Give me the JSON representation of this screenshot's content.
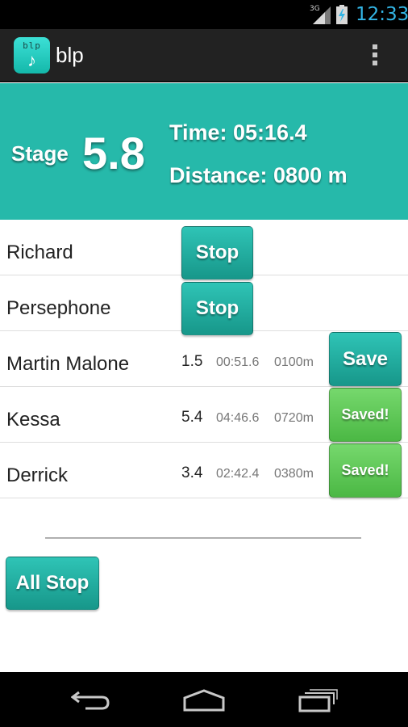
{
  "status_bar": {
    "network": "3G",
    "time": "12:33",
    "icons": [
      "signal-icon",
      "battery-charging-icon"
    ]
  },
  "action_bar": {
    "app_name": "blp",
    "app_icon_text": "blp",
    "app_icon_glyph": "♪",
    "overflow_icon": "overflow-menu-icon"
  },
  "stage": {
    "label": "Stage",
    "value": "5.8",
    "time_text": "Time: 05:16.4",
    "distance_text": "Distance: 0800 m"
  },
  "runners": [
    {
      "name": "Richard",
      "button": "Stop"
    },
    {
      "name": "Persephone",
      "button": "Stop"
    },
    {
      "name": "Martin Malone",
      "stage": "1.5",
      "time": "00:51.6",
      "distance": "0100m",
      "button": "Save"
    },
    {
      "name": "Kessa",
      "stage": "5.4",
      "time": "04:46.6",
      "distance": "0720m",
      "button": "Saved!"
    },
    {
      "name": "Derrick",
      "stage": "3.4",
      "time": "02:42.4",
      "distance": "0380m",
      "button": "Saved!"
    }
  ],
  "all_stop_label": "All Stop",
  "nav_bar": {
    "icons": [
      "back-icon",
      "home-icon",
      "recent-apps-icon"
    ]
  },
  "colors": {
    "accent": "#26b9aa",
    "saved": "#5cc654",
    "clock": "#33b5e5"
  }
}
